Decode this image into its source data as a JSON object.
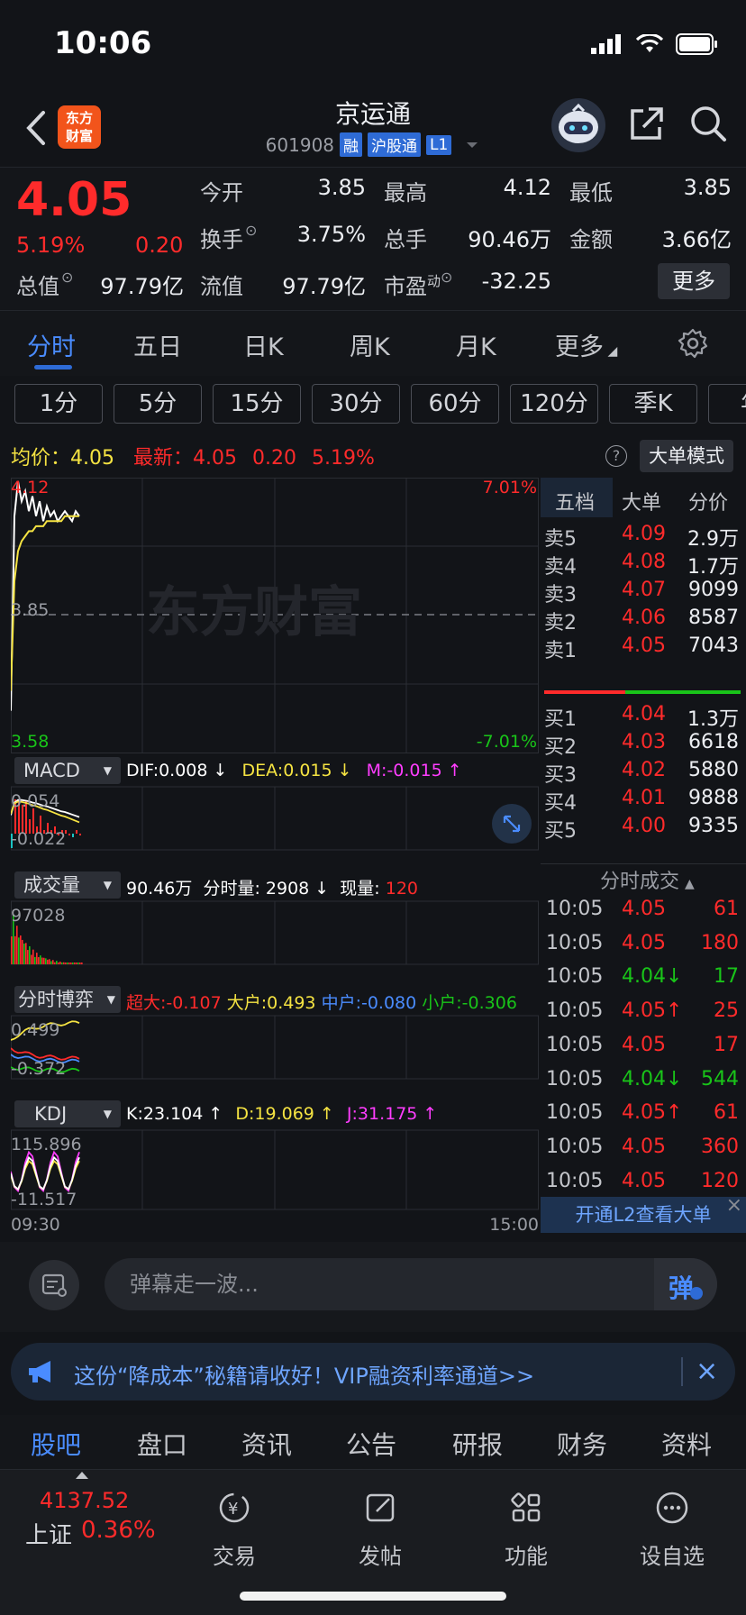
{
  "status": {
    "time": "10:06"
  },
  "header": {
    "logo_line1": "东方",
    "logo_line2": "财富",
    "stock_name": "京运通",
    "stock_code": "601908",
    "tags": [
      "融",
      "沪股通",
      "L1"
    ]
  },
  "quote": {
    "price": "4.05",
    "pct": "5.19%",
    "change": "0.20",
    "zongzhi_label": "总值",
    "zongzhi": "97.79亿",
    "kai_label": "今开",
    "kai": "3.85",
    "gao_label": "最高",
    "gao": "4.12",
    "di_label": "最低",
    "di": "3.85",
    "huanshou_label": "换手",
    "huanshou": "3.75%",
    "zongshou_label": "总手",
    "zongshou": "90.46万",
    "jine_label": "金额",
    "jine": "3.66亿",
    "liuzhi_label": "流值",
    "liuzhi": "97.79亿",
    "shiying_label": "市盈",
    "shiying_sup": "动",
    "shiying": "-32.25",
    "more": "更多"
  },
  "period_tabs": [
    "分时",
    "五日",
    "日K",
    "周K",
    "月K",
    "更多"
  ],
  "minute_tabs": [
    "1分",
    "5分",
    "15分",
    "30分",
    "60分",
    "120分",
    "季K",
    "年"
  ],
  "info_line": {
    "avg_label": "均价：",
    "avg": "4.05",
    "latest_label": "最新：",
    "latest": "4.05",
    "change": "0.20",
    "pct": "5.19%",
    "help": "?",
    "big_order": "大单模式"
  },
  "chart": {
    "price_high": "4.12",
    "price_mid": "3.85",
    "price_low": "3.58",
    "pct_high": "7.01%",
    "pct_low": "-7.01%",
    "watermark": "东方财富",
    "price_series": [
      3.66,
      4.05,
      4.12,
      4.08,
      4.1,
      4.06,
      4.09,
      4.05,
      4.08,
      4.04,
      4.07,
      4.05,
      4.06,
      4.04,
      4.05,
      4.06,
      4.05,
      4.04,
      4.06,
      4.05
    ],
    "avg_series": [
      3.7,
      3.92,
      3.98,
      4.0,
      4.01,
      4.02,
      4.02,
      4.03,
      4.03,
      4.03,
      4.04,
      4.04,
      4.04,
      4.04,
      4.04,
      4.05,
      4.05,
      4.05,
      4.05,
      4.05
    ],
    "macd_label": "MACD",
    "macd_dif": "DIF:0.008 ↓",
    "macd_dea": "DEA:0.015 ↓",
    "macd_m": "M:-0.015 ↑",
    "macd_high": "0.054",
    "macd_low": "-0.022",
    "vol_label": "成交量",
    "vol_total": "90.46万",
    "vol_min_label": "分时量:",
    "vol_min": "2908 ↓",
    "vol_now_label": "现量:",
    "vol_now": "120",
    "vol_max": "97028",
    "game_label": "分时博弈",
    "game_super_label": "超大:",
    "game_super": "-0.107",
    "game_big_label": "大户:",
    "game_big": "0.493",
    "game_mid_label": "中户:",
    "game_mid": "-0.080",
    "game_small_label": "小户:",
    "game_small": "-0.306",
    "game_high": "0.499",
    "game_low": "-0.372",
    "kdj_label": "KDJ",
    "kdj_k": "K:23.104 ↑",
    "kdj_d": "D:19.069 ↑",
    "kdj_j": "J:31.175 ↑",
    "kdj_high": "115.896",
    "kdj_low": "-11.517",
    "time_start": "09:30",
    "time_end": "15:00"
  },
  "order_book": {
    "tabs": [
      "五档",
      "大单",
      "分价"
    ],
    "sells": [
      {
        "label": "卖5",
        "price": "4.09",
        "vol": "2.9万"
      },
      {
        "label": "卖4",
        "price": "4.08",
        "vol": "1.7万"
      },
      {
        "label": "卖3",
        "price": "4.07",
        "vol": "9099"
      },
      {
        "label": "卖2",
        "price": "4.06",
        "vol": "8587"
      },
      {
        "label": "卖1",
        "price": "4.05",
        "vol": "7043"
      }
    ],
    "buys": [
      {
        "label": "买1",
        "price": "4.04",
        "vol": "1.3万"
      },
      {
        "label": "买2",
        "price": "4.03",
        "vol": "6618"
      },
      {
        "label": "买3",
        "price": "4.02",
        "vol": "5880"
      },
      {
        "label": "买4",
        "price": "4.01",
        "vol": "9888"
      },
      {
        "label": "买5",
        "price": "4.00",
        "vol": "9335"
      }
    ],
    "trades_title": "分时成交",
    "trades": [
      {
        "time": "10:05",
        "price": "4.05",
        "vol": "61",
        "color": "red"
      },
      {
        "time": "10:05",
        "price": "4.05",
        "vol": "180",
        "color": "red"
      },
      {
        "time": "10:05",
        "price": "4.04↓",
        "vol": "17",
        "color": "green"
      },
      {
        "time": "10:05",
        "price": "4.05↑",
        "vol": "25",
        "color": "red"
      },
      {
        "time": "10:05",
        "price": "4.05",
        "vol": "17",
        "color": "red"
      },
      {
        "time": "10:05",
        "price": "4.04↓",
        "vol": "544",
        "color": "green"
      },
      {
        "time": "10:05",
        "price": "4.05↑",
        "vol": "61",
        "color": "red"
      },
      {
        "time": "10:05",
        "price": "4.05",
        "vol": "360",
        "color": "red"
      },
      {
        "time": "10:05",
        "price": "4.05",
        "vol": "120",
        "color": "red"
      }
    ],
    "l2": "开通L2查看大单"
  },
  "danmu": {
    "placeholder": "弹幕走一波...",
    "send": "弹"
  },
  "banner": {
    "text": "这份“降成本”秘籍请收好！VIP融资利率通道>>",
    "close": "×"
  },
  "bottom_tabs": [
    "股吧",
    "盘口",
    "资讯",
    "公告",
    "研报",
    "财务",
    "资料"
  ],
  "nav": {
    "index_value": "4137.52",
    "index_name": "上证",
    "index_pct": "0.36%",
    "items": [
      "交易",
      "发帖",
      "功能",
      "设自选"
    ]
  }
}
